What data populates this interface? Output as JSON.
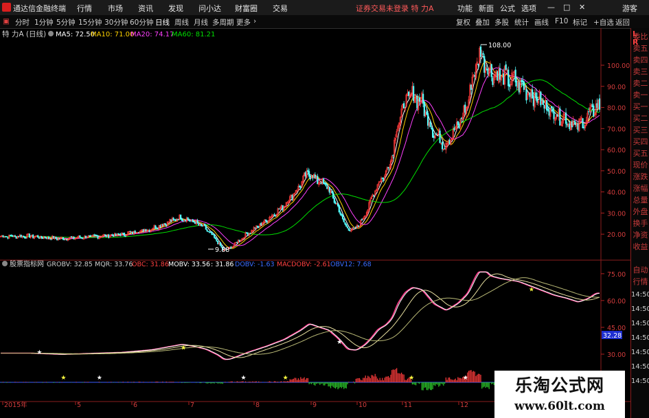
{
  "window": {
    "app_name": "通达信金融终端",
    "menus": [
      "行情",
      "市场",
      "资讯",
      "发现",
      "问小达",
      "财富圈",
      "交易"
    ],
    "notice": "证券交易未登录  特 力A",
    "right_menus": [
      "功能",
      "新面",
      "公式",
      "选项"
    ],
    "guest": "游客",
    "window_controls": [
      "—",
      "□",
      "✕"
    ]
  },
  "toolbar": {
    "periods": [
      "分时",
      "1分钟",
      "5分钟",
      "15分钟",
      "30分钟",
      "60分钟",
      "日线",
      "周线",
      "月线",
      "多周期",
      "更多"
    ],
    "active_period": "日线",
    "right_buttons": [
      "复权",
      "叠加",
      "多股",
      "统计",
      "画线",
      "F10",
      "标记",
      "+自选",
      "返回"
    ]
  },
  "price_panel": {
    "title": "特 力A (日线)",
    "ma_labels": [
      {
        "text": "MA5: 72.50",
        "color": "#ffffff"
      },
      {
        "text": "MA10: 71.00",
        "color": "#ffd200"
      },
      {
        "text": "MA20: 74.17",
        "color": "#ff40ff"
      },
      {
        "text": "MA60: 81.21",
        "color": "#00e000"
      }
    ],
    "high_label": "108.00",
    "low_label": "9.88"
  },
  "indicator_panel": {
    "title": "股票指标网",
    "labels": [
      {
        "text": "GROBV: 32.85",
        "color": "#cccccc"
      },
      {
        "text": "MQR: 33.76",
        "color": "#cccccc"
      },
      {
        "text": "OBC: 31.86",
        "color": "#ff4040"
      },
      {
        "text": "MOBV: 33.56",
        "color": "#ffffff"
      },
      {
        "text": ": 31.86",
        "color": "#ffffff"
      },
      {
        "text": "DOBV: -1.63",
        "color": "#3a6cff"
      },
      {
        "text": "MACDOBV: -2.61",
        "color": "#ff4040"
      },
      {
        "text": "OBV12: 7.68",
        "color": "#3a6cff"
      }
    ],
    "current_value": "32.28"
  },
  "sidebar": {
    "top_letters": [
      "L",
      "R"
    ],
    "tabs": [
      "委比",
      "卖五",
      "卖四",
      "卖三",
      "卖二",
      "卖一",
      "买一",
      "买二",
      "买三",
      "买四",
      "买五",
      "现价",
      "涨跌",
      "涨幅",
      "总量",
      "外盘",
      "换手",
      "净资",
      "收益"
    ],
    "bottom_tabs": [
      "自动",
      "行情"
    ],
    "times": [
      "14:50",
      "14:50",
      "14:50",
      "14:50",
      "14:50",
      "14:50",
      "14:50"
    ]
  },
  "watermark": {
    "line1": "乐淘公式网",
    "line2": "www.60lt.com"
  },
  "chart_data": [
    {
      "type": "candlestick",
      "title": "特 力A (日线)",
      "y_ticks": [
        20,
        30,
        40,
        50,
        60,
        70,
        80,
        90,
        100
      ],
      "y_tick_labels": [
        "20.00",
        "30.00",
        "40.00",
        "50.00",
        "60.00",
        "70.00",
        "80.00",
        "90.00",
        "100.00"
      ],
      "ylim": [
        9,
        113
      ],
      "x_ticks": [
        "2015年",
        "5",
        "6",
        "7",
        "8",
        "9",
        "10",
        "11",
        "12"
      ],
      "annotations": [
        {
          "text": "108.00",
          "value": 108
        },
        {
          "text": "9.88",
          "value": 9.88
        }
      ],
      "close_anchors": [
        [
          0,
          19.0
        ],
        [
          25,
          19.0
        ],
        [
          50,
          17.8
        ],
        [
          75,
          18.8
        ],
        [
          100,
          19.8
        ],
        [
          125,
          22.5
        ],
        [
          150,
          28
        ],
        [
          160,
          26
        ],
        [
          170,
          23
        ],
        [
          180,
          17
        ],
        [
          185,
          12.5
        ],
        [
          190,
          13
        ],
        [
          205,
          20
        ],
        [
          220,
          26
        ],
        [
          235,
          33
        ],
        [
          248,
          42
        ],
        [
          256,
          49
        ],
        [
          264,
          45.5
        ],
        [
          272,
          42.5
        ],
        [
          280,
          34
        ],
        [
          288,
          23
        ],
        [
          295,
          22
        ],
        [
          302,
          27.5
        ],
        [
          308,
          35
        ],
        [
          313,
          43
        ],
        [
          320,
          48
        ],
        [
          325,
          55
        ],
        [
          330,
          70
        ],
        [
          336,
          81
        ],
        [
          342,
          86
        ],
        [
          350,
          83.5
        ],
        [
          360,
          69
        ],
        [
          370,
          62.5
        ],
        [
          380,
          70
        ],
        [
          388,
          80
        ],
        [
          395,
          98
        ],
        [
          400,
          106
        ],
        [
          407,
          97.5
        ],
        [
          415,
          95
        ],
        [
          430,
          92
        ],
        [
          445,
          85
        ],
        [
          460,
          78
        ],
        [
          470,
          75
        ],
        [
          480,
          71
        ],
        [
          488,
          74.5
        ],
        [
          495,
          80
        ]
      ],
      "series": [
        {
          "name": "MA5",
          "color": "#ffffff",
          "last": 72.5
        },
        {
          "name": "MA10",
          "color": "#ffd200",
          "last": 71.0
        },
        {
          "name": "MA20",
          "color": "#ff40ff",
          "last": 74.17
        },
        {
          "name": "MA60",
          "color": "#00e000",
          "last": 81.21
        }
      ]
    },
    {
      "type": "line",
      "title": "股票指标网",
      "y_ticks": [
        30,
        45,
        60,
        75
      ],
      "y_tick_labels": [
        "30.00",
        "45.00",
        "60.00",
        "75.00"
      ],
      "series": [
        {
          "name": "GROBV",
          "color": "#ffffff",
          "last": 32.85
        },
        {
          "name": "MQR",
          "color": "#aaaaaa",
          "last": 33.76
        },
        {
          "name": "OBC",
          "color": "#ff4090",
          "last": 31.86
        },
        {
          "name": "MOBV",
          "color": "#ffffff",
          "last": 33.56
        },
        {
          "name": "DOBV",
          "color": "#3a6cff",
          "last": -1.63
        },
        {
          "name": "MACDOBV",
          "color": "#ff4040",
          "last": -2.61
        },
        {
          "name": "OBV12",
          "color": "#3a6cff",
          "last": 7.68
        }
      ]
    }
  ]
}
